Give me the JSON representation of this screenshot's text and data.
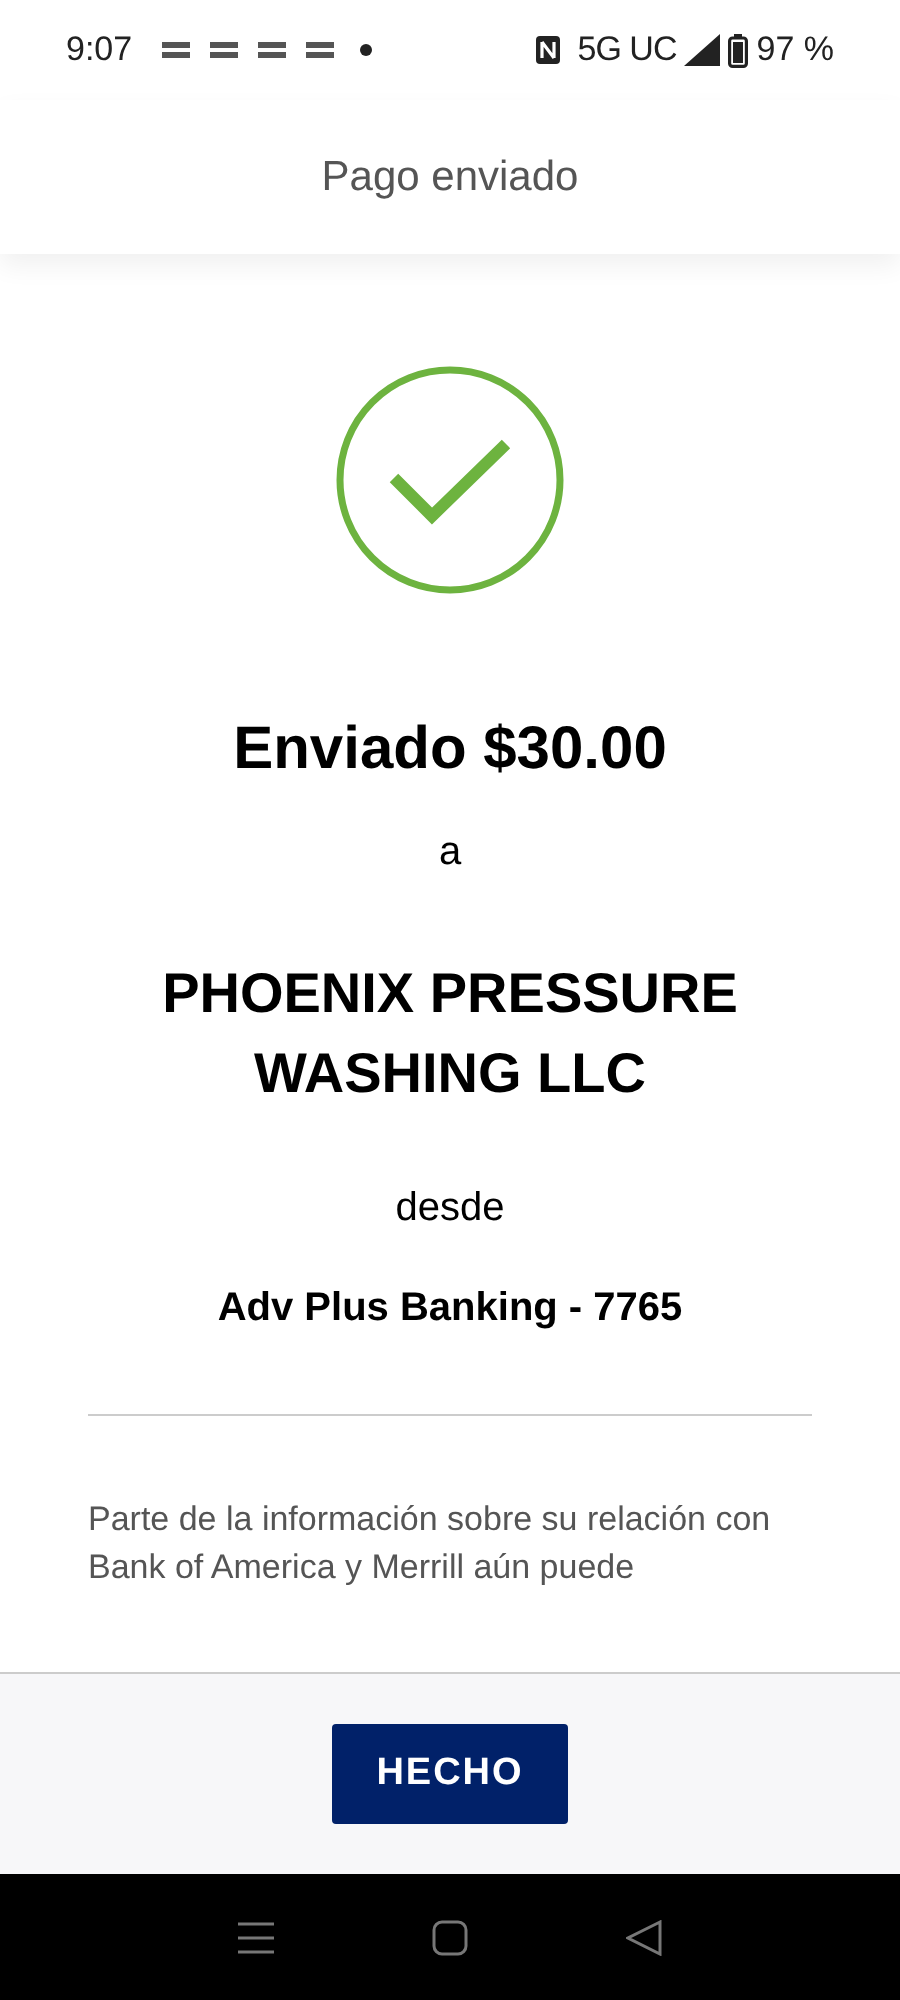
{
  "status_bar": {
    "time": "9:07",
    "network": "5G UC",
    "battery": "97 %"
  },
  "header": {
    "title": "Pago enviado"
  },
  "confirmation": {
    "headline": "Enviado $30.00",
    "to_label": "a",
    "recipient": "PHOENIX PRESSURE WASHING LLC",
    "from_label": "desde",
    "account": "Adv Plus Banking - 7765"
  },
  "disclosure": "Parte de la información sobre su relación con Bank of America y Merrill aún puede",
  "buttons": [
    {
      "label": "HECHO"
    }
  ]
}
